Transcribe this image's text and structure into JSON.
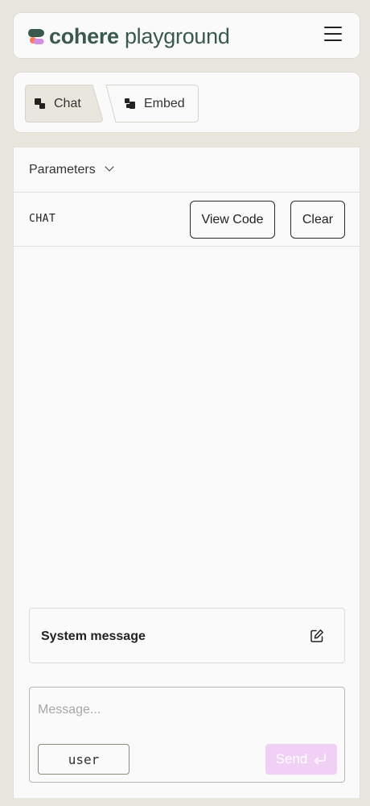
{
  "header": {
    "logo_text_primary": "cohere",
    "logo_text_secondary": "playground",
    "logo_colors": {
      "green": "#39594d",
      "coral": "#ff7759",
      "purple": "#d18ee2"
    },
    "menu_icon": "hamburger-menu-icon"
  },
  "tabs": [
    {
      "label": "Chat",
      "icon": "chat-icon",
      "active": true
    },
    {
      "label": "Embed",
      "icon": "embed-icon",
      "active": false
    }
  ],
  "panel": {
    "parameters_label": "Parameters",
    "mode_label": "CHAT",
    "view_code_label": "View Code",
    "clear_label": "Clear",
    "system_message_label": "System message",
    "message_placeholder": "Message...",
    "role_label": "user",
    "send_label": "Send"
  },
  "colors": {
    "background": "#e9e6dd",
    "active_tab": "#e9e6dd",
    "send_disabled": "#f0d0f5"
  }
}
